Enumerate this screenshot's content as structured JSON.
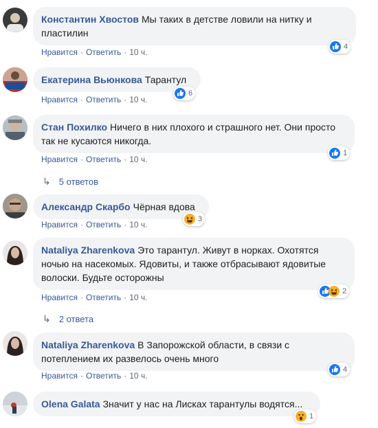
{
  "labels": {
    "like": "Нравится",
    "reply": "Ответить",
    "sep": "·"
  },
  "colors": {
    "link": "#385898",
    "bubble": "#f2f3f5",
    "like": "#1877f2",
    "haha": "#f7b125"
  },
  "comments": [
    {
      "author": "Константин Хвостов",
      "text": "Мы таких в детстве ловили на нитку и пластилин",
      "time": "10 ч.",
      "reaction_count": "4",
      "reactions": [
        "like-icon"
      ]
    },
    {
      "author": "Екатерина Вьюнкова",
      "text": "Тарантул",
      "time": "10 ч.",
      "reaction_count": "6",
      "reactions": [
        "like-icon"
      ]
    },
    {
      "author": "Стан Похилко",
      "text": "Ничего в них плохого и страшного нет. Они просто так не кусаются никогда.",
      "time": "10 ч.",
      "reaction_count": "1",
      "reactions": [
        "like-icon"
      ],
      "replies": "5 ответов"
    },
    {
      "author": "Александр Скарбо",
      "text": "Чёрная вдова",
      "time": "10 ч.",
      "reaction_count": "3",
      "reactions": [
        "haha-icon"
      ]
    },
    {
      "author": "Nataliya Zharenkova",
      "text": "Это тарантул. Живут в норках. Охотятся ночью на насекомых. Ядовиты, и также отбрасывают ядовитые волоски. Будьте осторожны",
      "time": "10 ч.",
      "reaction_count": "2",
      "reactions": [
        "like-icon",
        "haha-icon"
      ],
      "replies": "2 ответа"
    },
    {
      "author": "Nataliya Zharenkova",
      "text": "В Запорожской области, в связи с потеплением их развелось очень много",
      "time": "10 ч.",
      "reaction_count": "4",
      "reactions": [
        "like-icon"
      ]
    },
    {
      "author": "Olena Galata",
      "text": "Значит у нас на Лисках тарантулы водятся...",
      "time": "",
      "reaction_count": "1",
      "reactions": [
        "wow-icon"
      ]
    }
  ]
}
